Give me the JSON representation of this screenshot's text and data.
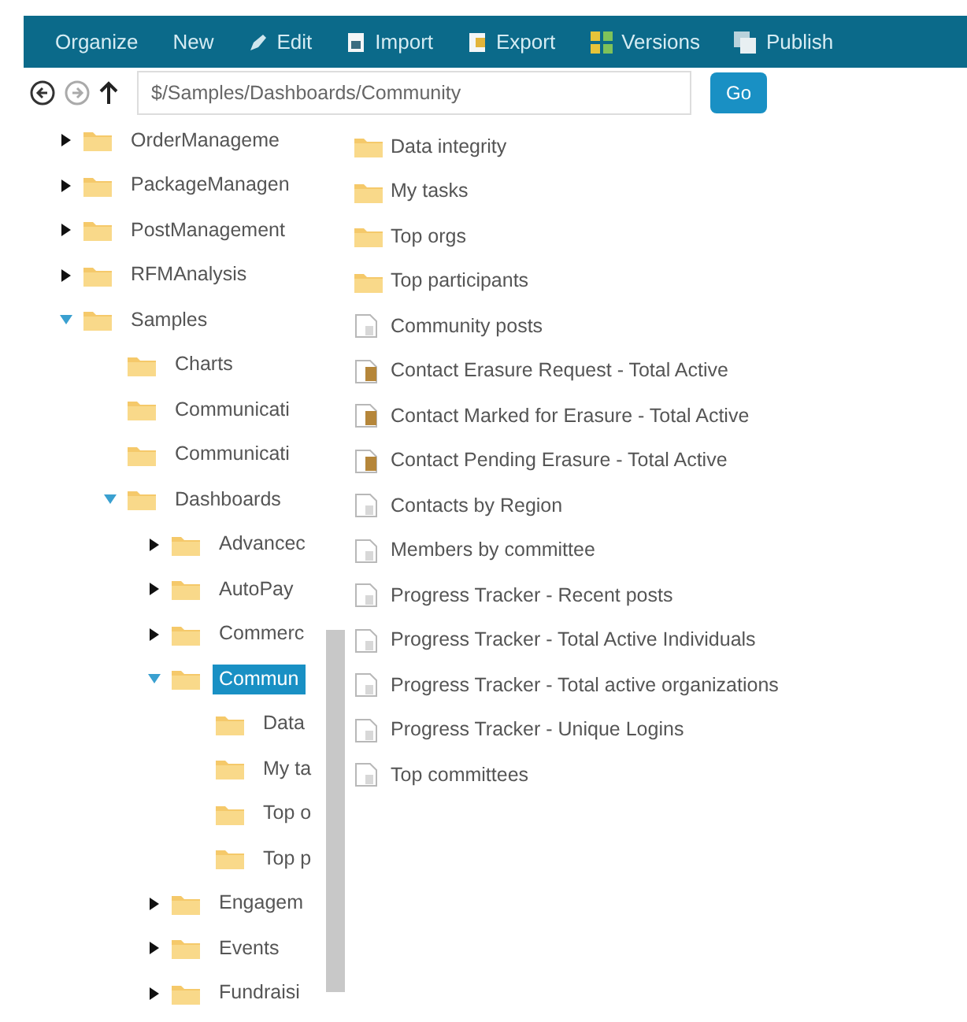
{
  "toolbar": [
    {
      "kind": "plain",
      "label": "Organize"
    },
    {
      "kind": "plain",
      "label": "New"
    },
    {
      "kind": "edit",
      "label": "Edit"
    },
    {
      "kind": "import",
      "label": "Import"
    },
    {
      "kind": "export",
      "label": "Export"
    },
    {
      "kind": "versions",
      "label": "Versions"
    },
    {
      "kind": "publish",
      "label": "Publish"
    }
  ],
  "address": {
    "value": "$/Samples/Dashboards/Community",
    "go": "Go"
  },
  "tree": [
    {
      "kind": "branch",
      "label": "OrderManageme",
      "expanded": false,
      "selected": false
    },
    {
      "kind": "branch",
      "label": "PackageManagen",
      "expanded": false,
      "selected": false
    },
    {
      "kind": "branch",
      "label": "PostManagement",
      "expanded": false,
      "selected": false
    },
    {
      "kind": "branch",
      "label": "RFMAnalysis",
      "expanded": false,
      "selected": false
    },
    {
      "kind": "branch",
      "label": "Samples",
      "expanded": true,
      "selected": false,
      "children": [
        {
          "kind": "leaf",
          "label": "Charts",
          "selected": false
        },
        {
          "kind": "leaf",
          "label": "Communicati",
          "selected": false
        },
        {
          "kind": "leaf",
          "label": "Communicati",
          "selected": false
        },
        {
          "kind": "branch",
          "label": "Dashboards",
          "expanded": true,
          "selected": false,
          "children": [
            {
              "kind": "branch",
              "label": "Advancec",
              "expanded": false,
              "selected": false
            },
            {
              "kind": "branch",
              "label": "AutoPay",
              "expanded": false,
              "selected": false
            },
            {
              "kind": "branch",
              "label": "Commerc",
              "expanded": false,
              "selected": false
            },
            {
              "kind": "branch",
              "label": "Commun",
              "expanded": true,
              "selected": true,
              "children": [
                {
                  "kind": "leaf",
                  "label": "Data",
                  "selected": false
                },
                {
                  "kind": "leaf",
                  "label": "My ta",
                  "selected": false
                },
                {
                  "kind": "leaf",
                  "label": "Top o",
                  "selected": false
                },
                {
                  "kind": "leaf",
                  "label": "Top p",
                  "selected": false
                }
              ]
            },
            {
              "kind": "branch",
              "label": "Engagem",
              "expanded": false,
              "selected": false
            },
            {
              "kind": "branch",
              "label": "Events",
              "expanded": false,
              "selected": false
            },
            {
              "kind": "branch",
              "label": "Fundraisi",
              "expanded": false,
              "selected": false
            }
          ]
        }
      ]
    }
  ],
  "contents": [
    {
      "kind": "folder",
      "label": "Data integrity"
    },
    {
      "kind": "folder",
      "label": "My tasks"
    },
    {
      "kind": "folder",
      "label": "Top orgs"
    },
    {
      "kind": "folder",
      "label": "Top participants"
    },
    {
      "kind": "report",
      "label": "Community posts"
    },
    {
      "kind": "locked",
      "label": "Contact Erasure Request - Total Active"
    },
    {
      "kind": "locked",
      "label": "Contact Marked for Erasure - Total Active"
    },
    {
      "kind": "locked",
      "label": "Contact Pending Erasure - Total Active"
    },
    {
      "kind": "report",
      "label": "Contacts by Region"
    },
    {
      "kind": "report",
      "label": "Members by committee"
    },
    {
      "kind": "report",
      "label": "Progress Tracker - Recent posts"
    },
    {
      "kind": "report",
      "label": "Progress Tracker - Total Active Individuals"
    },
    {
      "kind": "report",
      "label": "Progress Tracker - Total active organizations"
    },
    {
      "kind": "report",
      "label": "Progress Tracker - Unique Logins"
    },
    {
      "kind": "report",
      "label": "Top committees"
    }
  ]
}
